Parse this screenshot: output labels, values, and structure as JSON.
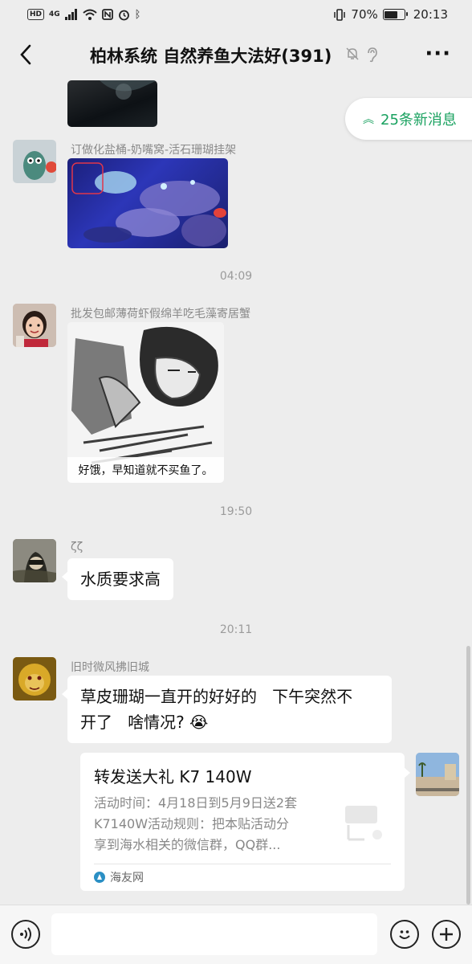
{
  "status_bar": {
    "left_badges": [
      "HD",
      "4G"
    ],
    "battery_percent": "70%",
    "battery_level": 0.7,
    "time": "20:13"
  },
  "header": {
    "back_icon": "chevron-left-icon",
    "title": "柏林系统 自然养鱼大法好(391)",
    "more_icon": "more-horizontal-icon",
    "more_label": "···"
  },
  "new_messages_pill": {
    "label": "25条新消息",
    "icon": "double-chevron-up-icon"
  },
  "messages": [
    {
      "sender": "订做化盐桶-奶嘴窝-活石珊瑚挂架",
      "type": "image"
    },
    {
      "time": "04:09"
    },
    {
      "sender": "批发包邮薄荷虾假绵羊吃毛藻寄居蟹",
      "type": "image",
      "image_caption": "好饿，早知道就不买鱼了。"
    },
    {
      "time": "19:50"
    },
    {
      "sender": "ζζ",
      "type": "text",
      "text": "水质要求高"
    },
    {
      "time": "20:11"
    },
    {
      "sender": "旧时微风拂旧城",
      "type": "text",
      "text_line1": "草皮珊瑚一直开的好好的   下午突然不",
      "text_line2": "开了   啥情况?",
      "emoji": "😭"
    },
    {
      "type": "link_card",
      "title": "转发送大礼 K7 140W",
      "desc_lines": [
        "活动时间：4月18日到5月9日送2套",
        "K7140W活动规则：把本贴活动分",
        "享到海水相关的微信群，QQ群..."
      ],
      "source": "海友网"
    }
  ],
  "input_bar": {
    "voice_icon": "voice-icon",
    "emoji_icon": "emoji-icon",
    "plus_icon": "plus-icon",
    "input_value": ""
  },
  "colors": {
    "background": "#ededed",
    "accent_green": "#1aa260",
    "bubble": "#ffffff"
  }
}
